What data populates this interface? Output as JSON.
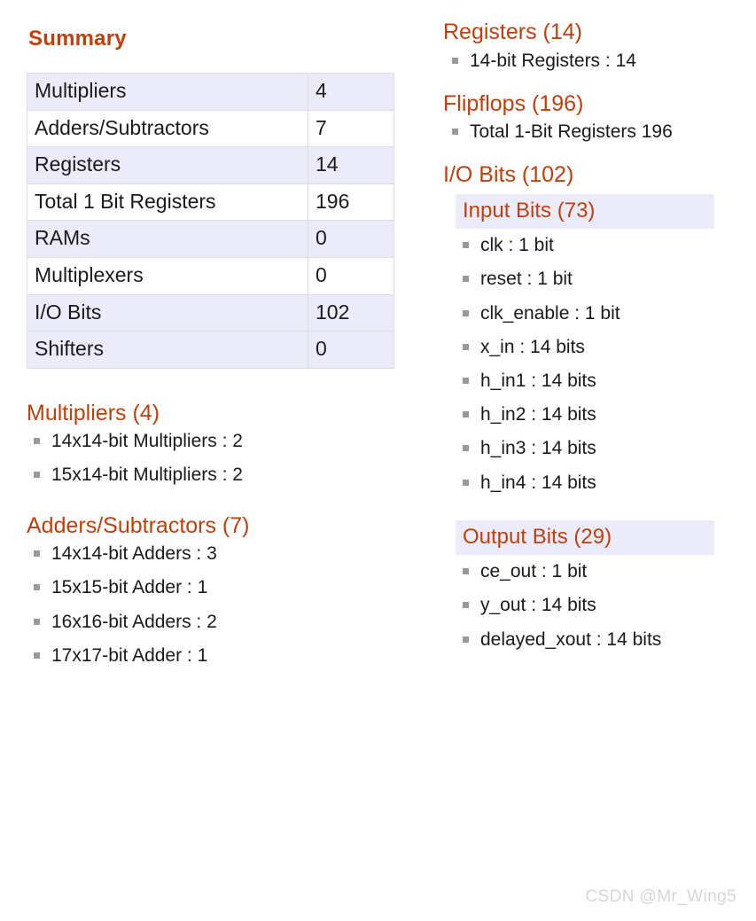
{
  "summary": {
    "title": "Summary",
    "rows": [
      {
        "label": "Multipliers",
        "value": "4"
      },
      {
        "label": "Adders/Subtractors",
        "value": "7"
      },
      {
        "label": "Registers",
        "value": "14"
      },
      {
        "label": "Total 1 Bit Registers",
        "value": "196"
      },
      {
        "label": "RAMs",
        "value": "0"
      },
      {
        "label": "Multiplexers",
        "value": "0"
      },
      {
        "label": "I/O Bits",
        "value": "102"
      },
      {
        "label": "Shifters",
        "value": "0"
      }
    ]
  },
  "left_sections": [
    {
      "heading": "Multipliers (4)",
      "items": [
        "14x14-bit Multipliers : 2",
        "15x14-bit Multipliers : 2"
      ]
    },
    {
      "heading": "Adders/Subtractors (7)",
      "items": [
        "14x14-bit Adders : 3",
        "15x15-bit Adder : 1",
        "16x16-bit Adders : 2",
        "17x17-bit Adder : 1"
      ]
    }
  ],
  "right_sections": {
    "registers": {
      "heading": "Registers (14)",
      "items": [
        "14-bit Registers : 14"
      ]
    },
    "flipflops": {
      "heading": "Flipflops (196)",
      "items": [
        "Total 1-Bit Registers 196"
      ]
    },
    "io_bits": {
      "heading": "I/O Bits (102)",
      "input": {
        "heading": "Input Bits (73)",
        "items": [
          "clk : 1 bit",
          "reset : 1 bit",
          "clk_enable : 1 bit",
          "x_in : 14 bits",
          "h_in1 : 14 bits",
          "h_in2 : 14 bits",
          "h_in3 : 14 bits",
          "h_in4 : 14 bits"
        ]
      },
      "output": {
        "heading": "Output Bits (29)",
        "items": [
          "ce_out : 1 bit",
          "y_out : 14 bits",
          "delayed_xout : 14 bits"
        ]
      }
    }
  },
  "watermark": "CSDN @Mr_Wing5",
  "colors": {
    "heading": "#c0400d",
    "row_shade": "#ecebfa",
    "text": "#1a1a1a",
    "bullet": "#9a9a9a",
    "watermark": "#d6d6d6"
  }
}
